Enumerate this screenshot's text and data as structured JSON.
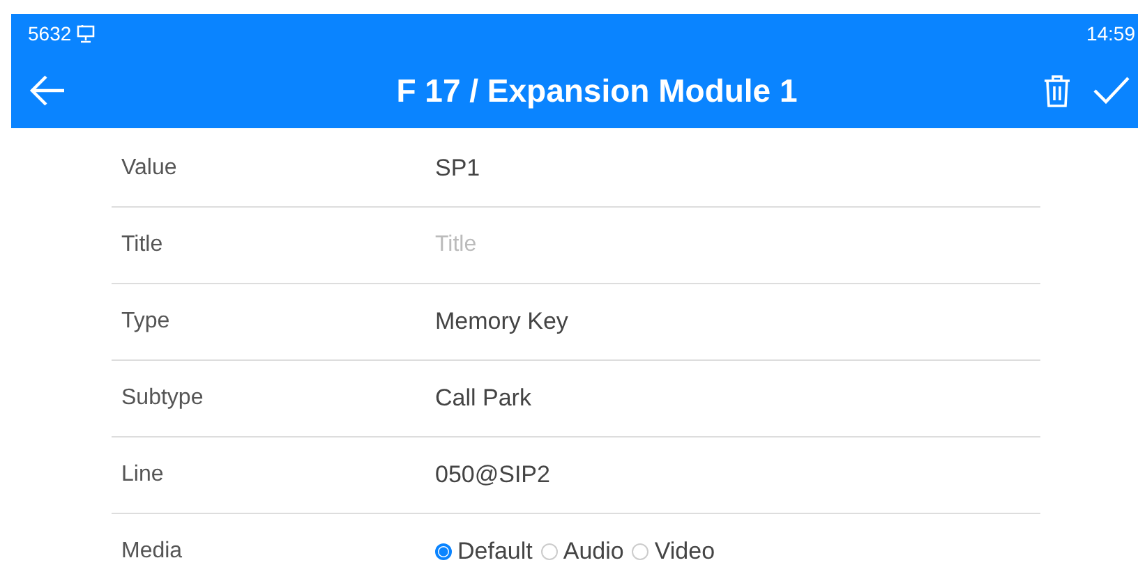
{
  "status_bar": {
    "extension": "5632",
    "time": "14:59"
  },
  "header": {
    "title": "F 17 / Expansion Module 1"
  },
  "fields": [
    {
      "kind": "text",
      "label": "Value",
      "value": "SP1"
    },
    {
      "kind": "input",
      "label": "Title",
      "placeholder": "Title"
    },
    {
      "kind": "text",
      "label": "Type",
      "value": "Memory Key"
    },
    {
      "kind": "text",
      "label": "Subtype",
      "value": "Call Park"
    },
    {
      "kind": "text",
      "label": "Line",
      "value": "050@SIP2"
    },
    {
      "kind": "radio",
      "label": "Media",
      "options": [
        {
          "label": "Default",
          "selected": true
        },
        {
          "label": "Audio",
          "selected": false
        },
        {
          "label": "Video",
          "selected": false
        }
      ]
    }
  ]
}
